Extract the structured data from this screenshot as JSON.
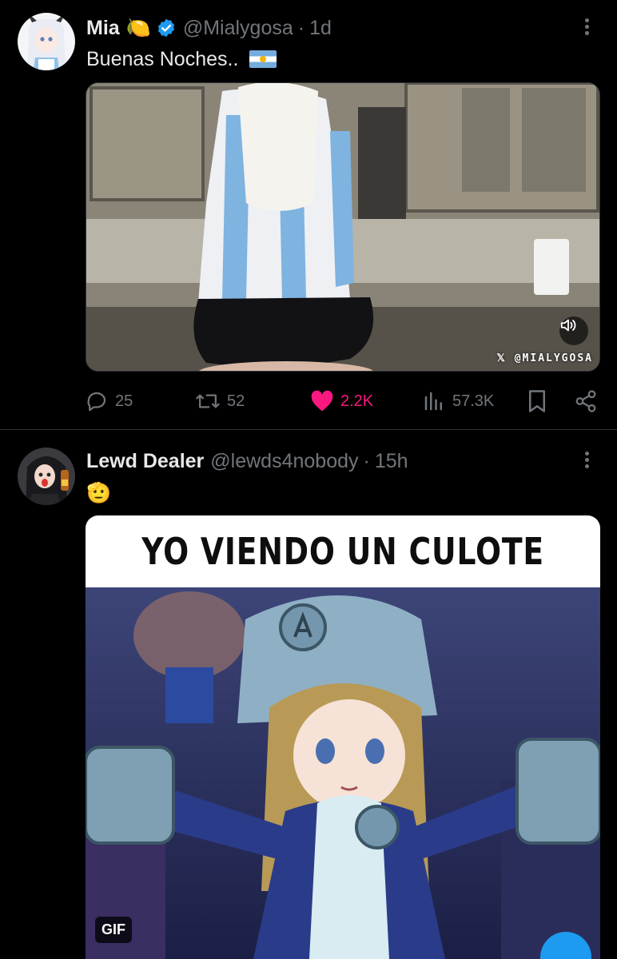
{
  "tweets": [
    {
      "author_name": "Mia",
      "name_emoji": "🍋",
      "verified": true,
      "handle": "@Mialygosa",
      "separator": "·",
      "time": "1d",
      "text": "Buenas Noches..",
      "text_emoji": "argentina-flag",
      "media": {
        "type": "video",
        "watermark": "𝕏 @MIALYGOSA",
        "sound_icon": "speaker-icon"
      },
      "stats": {
        "replies": "25",
        "reposts": "52",
        "likes": "2.2K",
        "views": "57.3K"
      }
    },
    {
      "author_name": "Lewd Dealer",
      "handle": "@lewds4nobody",
      "separator": "·",
      "time": "15h",
      "text_emoji": "🫡",
      "media": {
        "type": "gif",
        "caption": "YO VIENDO UN CULOTE",
        "badge": "GIF"
      }
    }
  ],
  "colors": {
    "background": "#000000",
    "text": "#e7e9ea",
    "muted": "#71767b",
    "verified": "#1d9bf0",
    "like": "#f91880",
    "fab": "#1d9bf0"
  }
}
